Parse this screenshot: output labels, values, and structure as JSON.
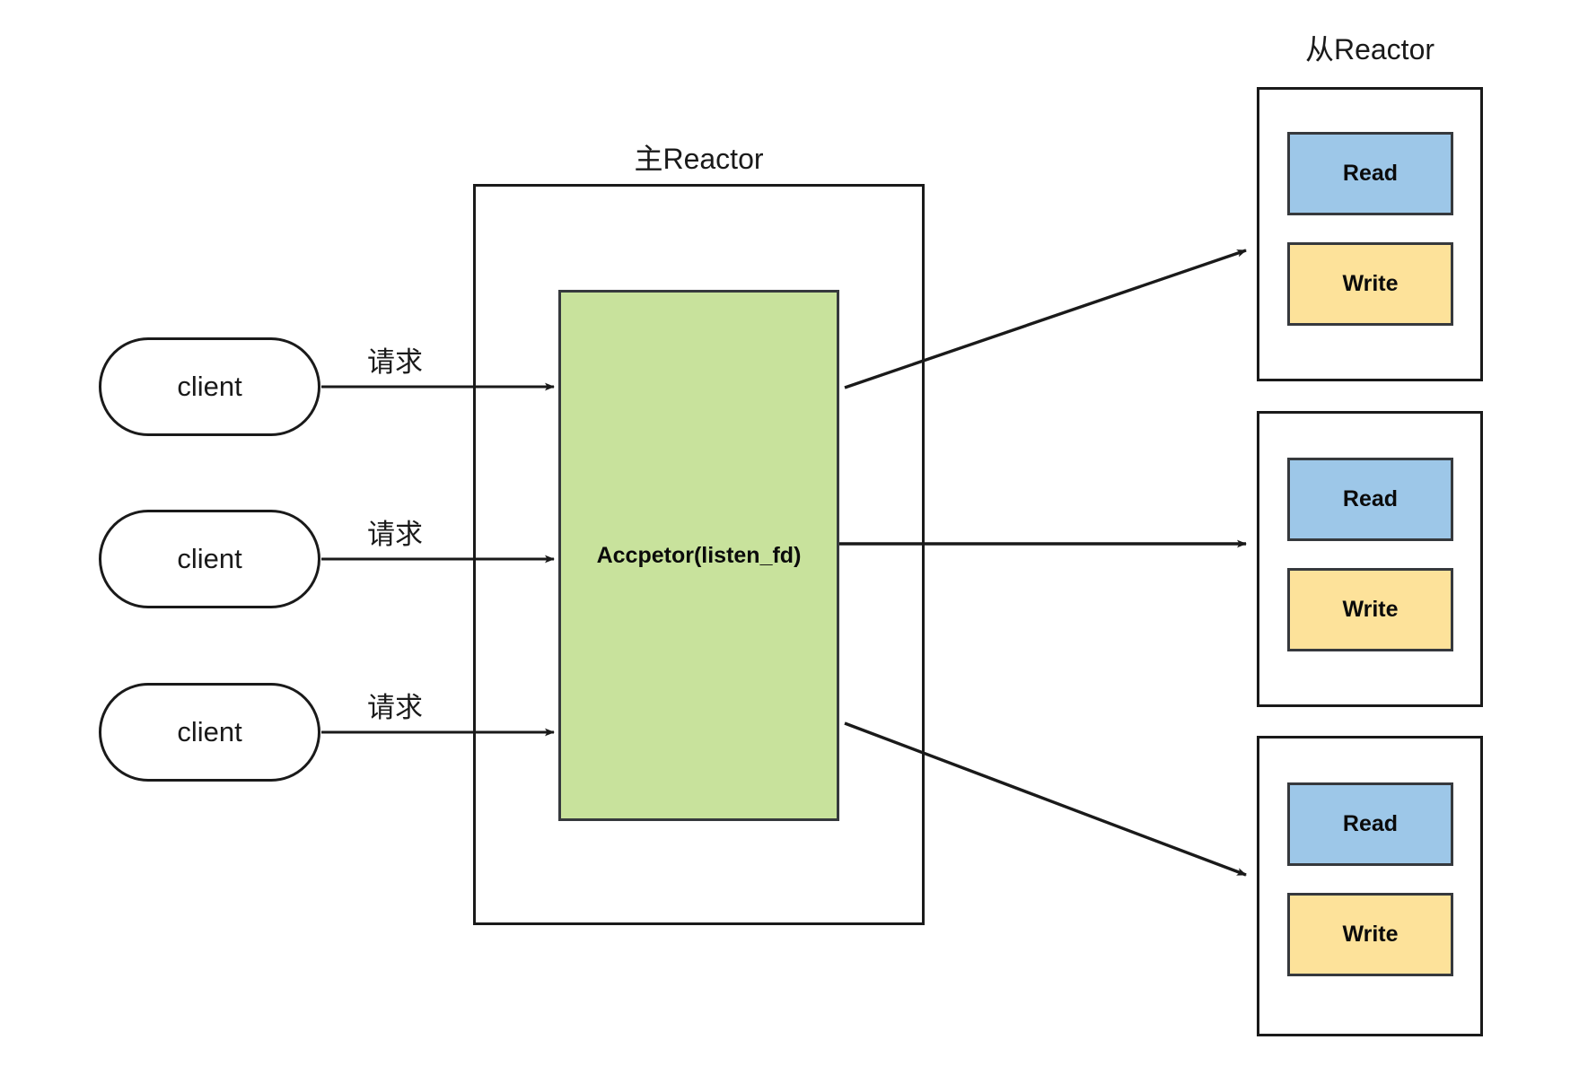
{
  "diagram": {
    "title_main_reactor": "主Reactor",
    "title_sub_reactor": "从Reactor",
    "background_color": "#ffffff",
    "stroke_color": "#1a1a1a"
  },
  "clients": [
    {
      "label": "client"
    },
    {
      "label": "client"
    },
    {
      "label": "client"
    }
  ],
  "edges": {
    "request_labels": [
      "请求",
      "请求",
      "请求"
    ]
  },
  "main_reactor": {
    "acceptor_label": "Accpetor(listen_fd)",
    "acceptor_fill": "#c8e29c"
  },
  "sub_reactors": [
    {
      "read_label": "Read",
      "write_label": "Write",
      "read_fill": "#9dc7e8",
      "write_fill": "#fde29a"
    },
    {
      "read_label": "Read",
      "write_label": "Write",
      "read_fill": "#9dc7e8",
      "write_fill": "#fde29a"
    },
    {
      "read_label": "Read",
      "write_label": "Write",
      "read_fill": "#9dc7e8",
      "write_fill": "#fde29a"
    }
  ]
}
